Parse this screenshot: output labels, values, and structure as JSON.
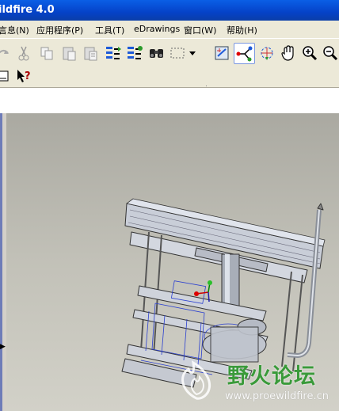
{
  "window": {
    "title_visible": "ildfire 4.0"
  },
  "menu": [
    {
      "label": "言息(N)"
    },
    {
      "label": "应用程序(P)"
    },
    {
      "label": "工具(T)"
    },
    {
      "label": "eDrawings"
    },
    {
      "label": "窗口(W)"
    },
    {
      "label": "帮助(H)"
    }
  ],
  "toolbar": {
    "icons": [
      "redo-icon",
      "cut-icon",
      "copy-icon",
      "paste-icon",
      "paste-special-icon",
      "regenerate-icon",
      "regenerate-manager-icon",
      "find-icon",
      "select-box-icon",
      "dropdown-arrow-icon",
      "datum-display-icon",
      "datum-axis-icon",
      "spin-center-icon",
      "pan-hand-icon",
      "zoom-in-icon",
      "zoom-out-icon"
    ],
    "row2_icons": [
      "save-display-icon",
      "context-help-icon"
    ]
  },
  "watermark": {
    "text": "野火论坛",
    "url": "www.proewildfire.cn"
  },
  "colors": {
    "title_bar": "#0542c8",
    "menu_bg": "#ece9d8",
    "viewport_bg": "#c2c1b8",
    "watermark": "#3a9a3a"
  }
}
